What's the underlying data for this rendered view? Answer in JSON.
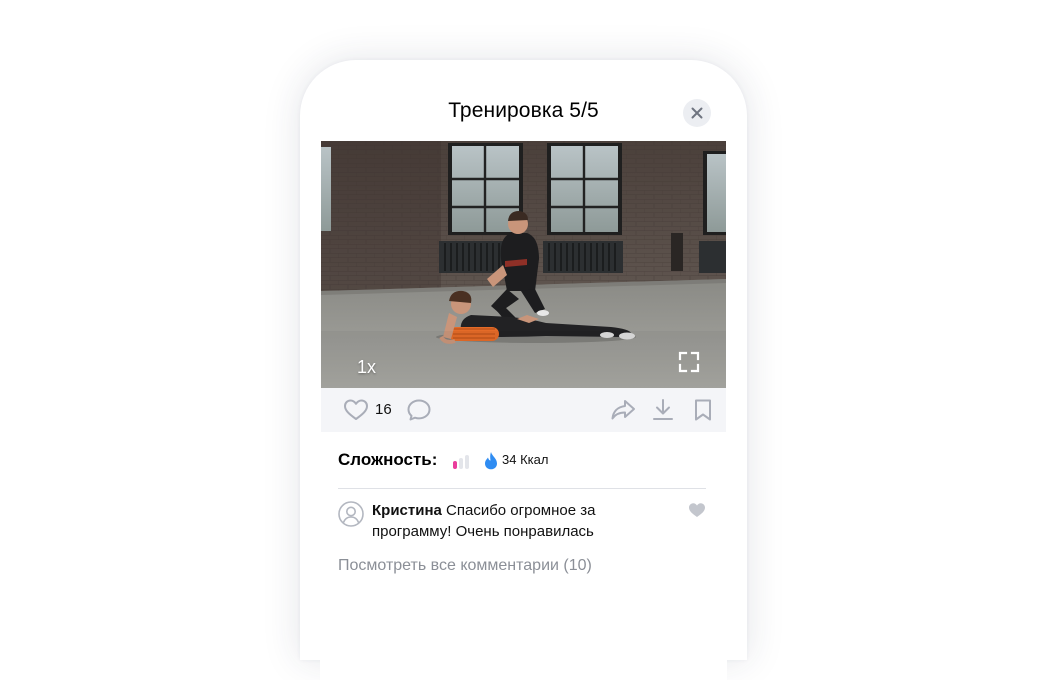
{
  "header": {
    "title": "Тренировка 5/5"
  },
  "video": {
    "speed_label": "1x"
  },
  "actions": {
    "likes_count": "16"
  },
  "difficulty": {
    "label": "Сложность:",
    "level": 1,
    "level_max": 3,
    "calories": "34 Ккал"
  },
  "comment": {
    "author": "Кристина",
    "text": "Спасибо огромное за программу! Очень понравилась"
  },
  "view_all_comments": "Посмотреть все комментарии (10)",
  "colors": {
    "difficulty_active": "#ea3d9c",
    "difficulty_inactive": "#e3e5ea",
    "flame": "#2f8cf2",
    "action_icons": "#a9adb8",
    "action_bar_bg": "#f4f5f8"
  },
  "icons": {
    "close": "close-icon",
    "like": "heart-outline-icon",
    "comment": "comment-bubble-icon",
    "share": "share-arrow-icon",
    "download": "download-icon",
    "bookmark": "bookmark-icon",
    "fullscreen": "fullscreen-icon",
    "calories": "flame-icon",
    "avatar": "user-avatar-icon",
    "comment_like": "heart-filled-icon"
  }
}
